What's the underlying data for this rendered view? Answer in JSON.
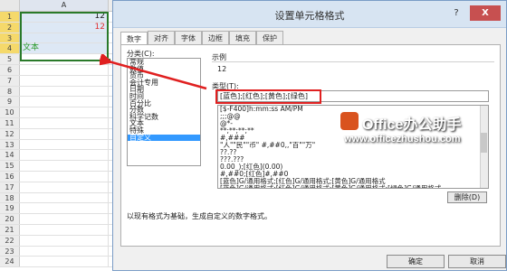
{
  "sheet": {
    "column_header": "A",
    "rows": [
      {
        "num": "1",
        "value": "12"
      },
      {
        "num": "2",
        "value": "12"
      },
      {
        "num": "3",
        "value": ""
      },
      {
        "num": "4",
        "value": "文本"
      },
      {
        "num": "5",
        "value": ""
      },
      {
        "num": "6",
        "value": ""
      },
      {
        "num": "7",
        "value": ""
      },
      {
        "num": "8",
        "value": ""
      },
      {
        "num": "9",
        "value": ""
      },
      {
        "num": "10",
        "value": ""
      },
      {
        "num": "11",
        "value": ""
      },
      {
        "num": "12",
        "value": ""
      },
      {
        "num": "13",
        "value": ""
      },
      {
        "num": "14",
        "value": ""
      },
      {
        "num": "15",
        "value": ""
      },
      {
        "num": "16",
        "value": ""
      },
      {
        "num": "17",
        "value": ""
      },
      {
        "num": "18",
        "value": ""
      },
      {
        "num": "19",
        "value": ""
      },
      {
        "num": "20",
        "value": ""
      },
      {
        "num": "21",
        "value": ""
      },
      {
        "num": "22",
        "value": ""
      },
      {
        "num": "23",
        "value": ""
      },
      {
        "num": "24",
        "value": ""
      }
    ],
    "colors": {
      "red_value": "#e03030",
      "green_text": "#2a9a2a",
      "selection_border": "#2a7a2a"
    }
  },
  "dialog": {
    "title": "设置单元格格式",
    "help": "?",
    "close": "X",
    "tabs": [
      "数字",
      "对齐",
      "字体",
      "边框",
      "填充",
      "保护"
    ],
    "category_label": "分类(C):",
    "categories": [
      "常规",
      "数值",
      "货币",
      "会计专用",
      "日期",
      "时间",
      "百分比",
      "分数",
      "科学记数",
      "文本",
      "特殊",
      "自定义"
    ],
    "selected_category": "自定义",
    "sample_label": "示例",
    "sample_value": "12",
    "type_label": "类型(T):",
    "type_value": "[蓝色];[红色];[黄色];[绿色]",
    "format_list": [
      "[$-F400]h:mm:ss AM/PM",
      ";;;@@",
      "@*-",
      "**;**;**;**",
      "#,###",
      "\"人\"\"民\"\"币\" #,##0,,\"百\"\"万\"",
      "??.??",
      "???.???",
      "0.00_);[红色](0.00)",
      "#,##0;[红色]#,##0",
      "[蓝色]G/通用格式;[红色]G/通用格式;[黄色]G/通用格式",
      "[蓝色]G/通用格式;[红色]G/通用格式;[黄色]G/通用格式;[绿色]G/通用格式"
    ],
    "delete_label": "删除(D)",
    "description": "以现有格式为基础，生成自定义的数字格式。",
    "ok_label": "确定",
    "cancel_label": "取消"
  },
  "watermark": {
    "line1": "Office办公助手",
    "line2": "www.officezhushou.com"
  }
}
